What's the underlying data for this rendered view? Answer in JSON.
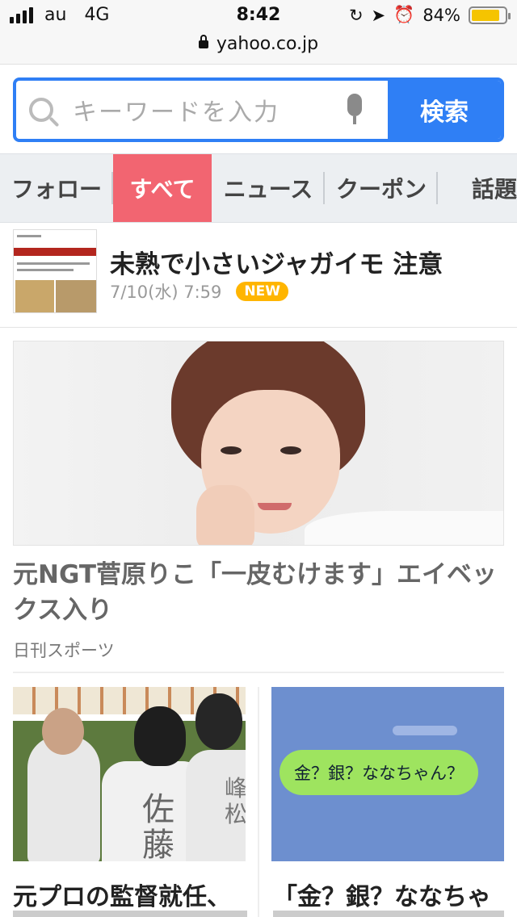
{
  "status_bar": {
    "carrier": "au",
    "network": "4G",
    "time": "8:42",
    "battery_percent_label": "84%",
    "battery_level": 0.84,
    "url": "yahoo.co.jp"
  },
  "search": {
    "placeholder": "キーワードを入力",
    "button_label": "検索"
  },
  "tabs": [
    {
      "label": "フォロー",
      "active": false
    },
    {
      "label": "すべて",
      "active": true
    },
    {
      "label": "ニュース",
      "active": false
    },
    {
      "label": "クーポン",
      "active": false
    },
    {
      "label": "話題",
      "active": false
    }
  ],
  "headline": {
    "title": "未熟で小さいジャガイモ 注意",
    "time": "7/10(水) 7:59",
    "badge": "NEW"
  },
  "feature": {
    "title": "元NGT菅原りこ「一皮むけます」エイベックス入り",
    "source": "日刊スポーツ"
  },
  "cards": [
    {
      "title": "元プロの監督就任、"
    },
    {
      "title": "「金？銀？ななちゃ",
      "bubble_text": "金？銀？ななちゃん？"
    }
  ],
  "colors": {
    "accent_blue": "#2f7ff5",
    "active_tab": "#f26571",
    "new_badge": "#ffb500"
  }
}
